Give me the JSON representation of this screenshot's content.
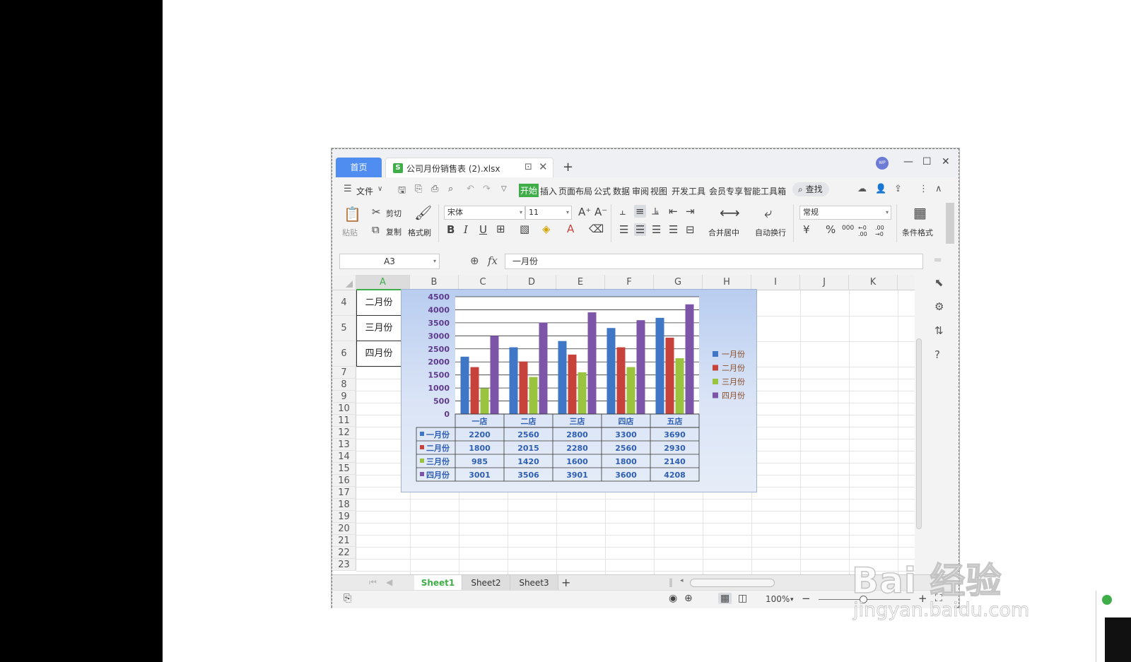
{
  "titlebar": {
    "home_tab": "首页",
    "file_icon_letter": "S",
    "file_tab": "公司月份销售表 (2).xlsx",
    "new_tab": "+",
    "avatar": "WP"
  },
  "menu": {
    "file": "文件",
    "tabs": [
      "开始",
      "插入",
      "页面布局",
      "公式",
      "数据",
      "审阅",
      "视图",
      "开发工具",
      "会员专享",
      "智能工具箱"
    ],
    "search": "查找"
  },
  "ribbon": {
    "paste": "粘贴",
    "cut": "剪切",
    "copy": "复制",
    "format_painter": "格式刷",
    "font_name": "宋体",
    "font_size": "11",
    "merge_center": "合并居中",
    "wrap_text": "自动换行",
    "number_format": "常规",
    "conditional_format": "条件格式",
    "currency": "¥",
    "percent": "%",
    "thousands": "000",
    "inc_decimal": "←0 .00",
    "dec_decimal": ".00 →0"
  },
  "formula_bar": {
    "name_box": "A3",
    "fx": "fx",
    "value": "一月份"
  },
  "grid": {
    "columns": [
      "A",
      "B",
      "C",
      "D",
      "E",
      "F",
      "G",
      "H",
      "I",
      "J",
      "K"
    ],
    "rows": [
      "4",
      "5",
      "6",
      "7",
      "8",
      "9",
      "10",
      "11",
      "12",
      "13",
      "14",
      "15",
      "16",
      "17",
      "18",
      "19",
      "20",
      "21",
      "22",
      "23"
    ],
    "column_a_cells": [
      "二月份",
      "三月份",
      "四月份"
    ]
  },
  "chart_data": {
    "type": "bar",
    "categories": [
      "一店",
      "二店",
      "三店",
      "四店",
      "五店"
    ],
    "series": [
      {
        "name": "一月份",
        "color": "#3f76c6",
        "values": [
          2200,
          2560,
          2800,
          3300,
          3690
        ]
      },
      {
        "name": "二月份",
        "color": "#c7423a",
        "values": [
          1800,
          2015,
          2280,
          2560,
          2930
        ]
      },
      {
        "name": "三月份",
        "color": "#9ac33f",
        "values": [
          985,
          1420,
          1600,
          1800,
          2140
        ]
      },
      {
        "name": "四月份",
        "color": "#7d55a8",
        "values": [
          3001,
          3506,
          3901,
          3600,
          4208
        ]
      }
    ],
    "y_ticks": [
      "0",
      "500",
      "1000",
      "1500",
      "2000",
      "2500",
      "3000",
      "3500",
      "4000",
      "4500"
    ],
    "ylim": [
      0,
      4500
    ],
    "legend_position": "right",
    "data_table": true,
    "grid": true
  },
  "sheets": {
    "tabs": [
      "Sheet1",
      "Sheet2",
      "Sheet3"
    ],
    "active": "Sheet1",
    "add": "+"
  },
  "status": {
    "zoom": "100%",
    "minus": "−",
    "plus": "+"
  },
  "watermark": {
    "brand": "Bai  经验",
    "url": "jingyan.baidu.com"
  }
}
